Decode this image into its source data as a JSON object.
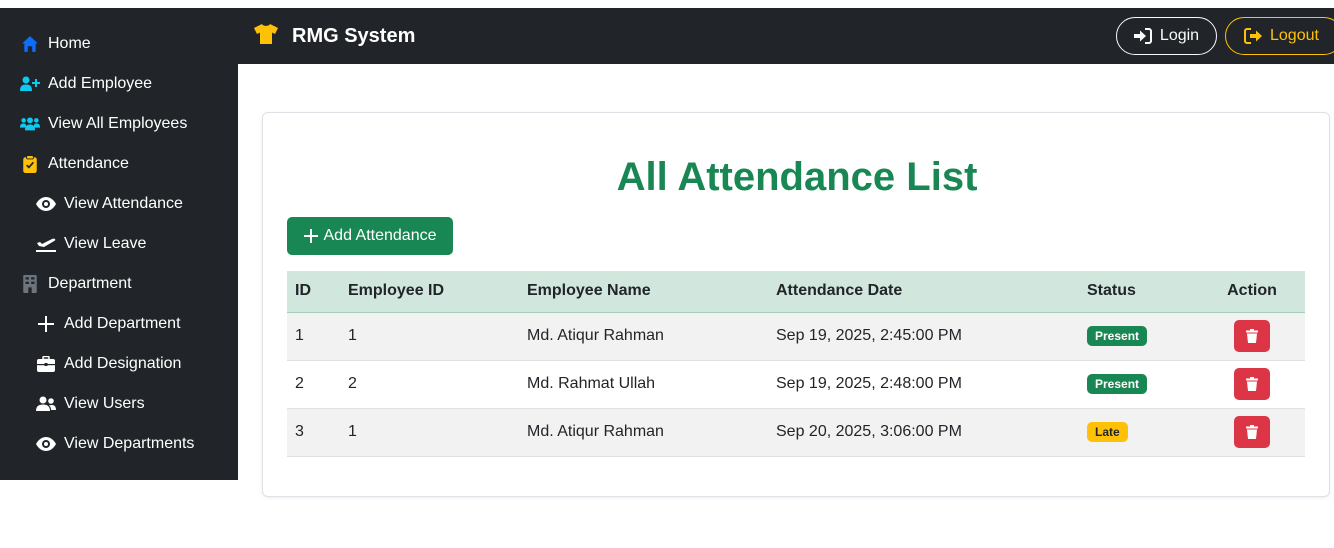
{
  "app": {
    "brand": "RMG System"
  },
  "header": {
    "login_label": "Login",
    "logout_label": "Logout"
  },
  "sidebar": {
    "items": [
      {
        "label": "Home",
        "icon": "home-icon"
      },
      {
        "label": "Add Employee",
        "icon": "user-plus-icon"
      },
      {
        "label": "View All Employees",
        "icon": "users-icon"
      },
      {
        "label": "Attendance",
        "icon": "clipboard-check-icon"
      },
      {
        "label": "View Attendance",
        "icon": "eye-icon"
      },
      {
        "label": "View Leave",
        "icon": "plane-departure-icon"
      },
      {
        "label": "Department",
        "icon": "building-icon"
      },
      {
        "label": "Add Department",
        "icon": "plus-icon"
      },
      {
        "label": "Add Designation",
        "icon": "briefcase-icon"
      },
      {
        "label": "View Users",
        "icon": "users-icon"
      },
      {
        "label": "View Departments",
        "icon": "eye-icon"
      }
    ]
  },
  "main": {
    "title": "All Attendance List",
    "add_button_label": "Add Attendance",
    "table": {
      "headers": [
        "ID",
        "Employee ID",
        "Employee Name",
        "Attendance Date",
        "Status",
        "Action"
      ],
      "rows": [
        {
          "id": "1",
          "employee_id": "1",
          "name": "Md. Atiqur Rahman",
          "date": "Sep 19, 2025, 2:45:00 PM",
          "status": "Present"
        },
        {
          "id": "2",
          "employee_id": "2",
          "name": "Md. Rahmat Ullah",
          "date": "Sep 19, 2025, 2:48:00 PM",
          "status": "Present"
        },
        {
          "id": "3",
          "employee_id": "1",
          "name": "Md. Atiqur Rahman",
          "date": "Sep 20, 2025, 3:06:00 PM",
          "status": "Late"
        }
      ]
    }
  },
  "colors": {
    "sidebar_bg": "#212529",
    "title_green": "#198754",
    "table_header_bg": "#d1e7dd",
    "present_badge": "#198754",
    "late_badge": "#ffc107",
    "delete_button": "#dc3545",
    "logout_accent": "#ffc107",
    "icon_blue": "#0d6efd",
    "icon_cyan": "#0dcaf0"
  }
}
